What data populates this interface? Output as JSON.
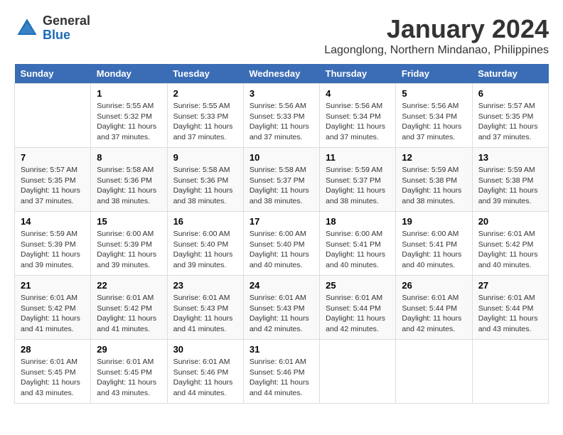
{
  "header": {
    "logo_general": "General",
    "logo_blue": "Blue",
    "month_title": "January 2024",
    "location": "Lagonglong, Northern Mindanao, Philippines"
  },
  "calendar": {
    "weekdays": [
      "Sunday",
      "Monday",
      "Tuesday",
      "Wednesday",
      "Thursday",
      "Friday",
      "Saturday"
    ],
    "weeks": [
      [
        {
          "day": "",
          "info": ""
        },
        {
          "day": "1",
          "info": "Sunrise: 5:55 AM\nSunset: 5:32 PM\nDaylight: 11 hours\nand 37 minutes."
        },
        {
          "day": "2",
          "info": "Sunrise: 5:55 AM\nSunset: 5:33 PM\nDaylight: 11 hours\nand 37 minutes."
        },
        {
          "day": "3",
          "info": "Sunrise: 5:56 AM\nSunset: 5:33 PM\nDaylight: 11 hours\nand 37 minutes."
        },
        {
          "day": "4",
          "info": "Sunrise: 5:56 AM\nSunset: 5:34 PM\nDaylight: 11 hours\nand 37 minutes."
        },
        {
          "day": "5",
          "info": "Sunrise: 5:56 AM\nSunset: 5:34 PM\nDaylight: 11 hours\nand 37 minutes."
        },
        {
          "day": "6",
          "info": "Sunrise: 5:57 AM\nSunset: 5:35 PM\nDaylight: 11 hours\nand 37 minutes."
        }
      ],
      [
        {
          "day": "7",
          "info": "Sunrise: 5:57 AM\nSunset: 5:35 PM\nDaylight: 11 hours\nand 37 minutes."
        },
        {
          "day": "8",
          "info": "Sunrise: 5:58 AM\nSunset: 5:36 PM\nDaylight: 11 hours\nand 38 minutes."
        },
        {
          "day": "9",
          "info": "Sunrise: 5:58 AM\nSunset: 5:36 PM\nDaylight: 11 hours\nand 38 minutes."
        },
        {
          "day": "10",
          "info": "Sunrise: 5:58 AM\nSunset: 5:37 PM\nDaylight: 11 hours\nand 38 minutes."
        },
        {
          "day": "11",
          "info": "Sunrise: 5:59 AM\nSunset: 5:37 PM\nDaylight: 11 hours\nand 38 minutes."
        },
        {
          "day": "12",
          "info": "Sunrise: 5:59 AM\nSunset: 5:38 PM\nDaylight: 11 hours\nand 38 minutes."
        },
        {
          "day": "13",
          "info": "Sunrise: 5:59 AM\nSunset: 5:38 PM\nDaylight: 11 hours\nand 39 minutes."
        }
      ],
      [
        {
          "day": "14",
          "info": "Sunrise: 5:59 AM\nSunset: 5:39 PM\nDaylight: 11 hours\nand 39 minutes."
        },
        {
          "day": "15",
          "info": "Sunrise: 6:00 AM\nSunset: 5:39 PM\nDaylight: 11 hours\nand 39 minutes."
        },
        {
          "day": "16",
          "info": "Sunrise: 6:00 AM\nSunset: 5:40 PM\nDaylight: 11 hours\nand 39 minutes."
        },
        {
          "day": "17",
          "info": "Sunrise: 6:00 AM\nSunset: 5:40 PM\nDaylight: 11 hours\nand 40 minutes."
        },
        {
          "day": "18",
          "info": "Sunrise: 6:00 AM\nSunset: 5:41 PM\nDaylight: 11 hours\nand 40 minutes."
        },
        {
          "day": "19",
          "info": "Sunrise: 6:00 AM\nSunset: 5:41 PM\nDaylight: 11 hours\nand 40 minutes."
        },
        {
          "day": "20",
          "info": "Sunrise: 6:01 AM\nSunset: 5:42 PM\nDaylight: 11 hours\nand 40 minutes."
        }
      ],
      [
        {
          "day": "21",
          "info": "Sunrise: 6:01 AM\nSunset: 5:42 PM\nDaylight: 11 hours\nand 41 minutes."
        },
        {
          "day": "22",
          "info": "Sunrise: 6:01 AM\nSunset: 5:42 PM\nDaylight: 11 hours\nand 41 minutes."
        },
        {
          "day": "23",
          "info": "Sunrise: 6:01 AM\nSunset: 5:43 PM\nDaylight: 11 hours\nand 41 minutes."
        },
        {
          "day": "24",
          "info": "Sunrise: 6:01 AM\nSunset: 5:43 PM\nDaylight: 11 hours\nand 42 minutes."
        },
        {
          "day": "25",
          "info": "Sunrise: 6:01 AM\nSunset: 5:44 PM\nDaylight: 11 hours\nand 42 minutes."
        },
        {
          "day": "26",
          "info": "Sunrise: 6:01 AM\nSunset: 5:44 PM\nDaylight: 11 hours\nand 42 minutes."
        },
        {
          "day": "27",
          "info": "Sunrise: 6:01 AM\nSunset: 5:44 PM\nDaylight: 11 hours\nand 43 minutes."
        }
      ],
      [
        {
          "day": "28",
          "info": "Sunrise: 6:01 AM\nSunset: 5:45 PM\nDaylight: 11 hours\nand 43 minutes."
        },
        {
          "day": "29",
          "info": "Sunrise: 6:01 AM\nSunset: 5:45 PM\nDaylight: 11 hours\nand 43 minutes."
        },
        {
          "day": "30",
          "info": "Sunrise: 6:01 AM\nSunset: 5:46 PM\nDaylight: 11 hours\nand 44 minutes."
        },
        {
          "day": "31",
          "info": "Sunrise: 6:01 AM\nSunset: 5:46 PM\nDaylight: 11 hours\nand 44 minutes."
        },
        {
          "day": "",
          "info": ""
        },
        {
          "day": "",
          "info": ""
        },
        {
          "day": "",
          "info": ""
        }
      ]
    ]
  }
}
